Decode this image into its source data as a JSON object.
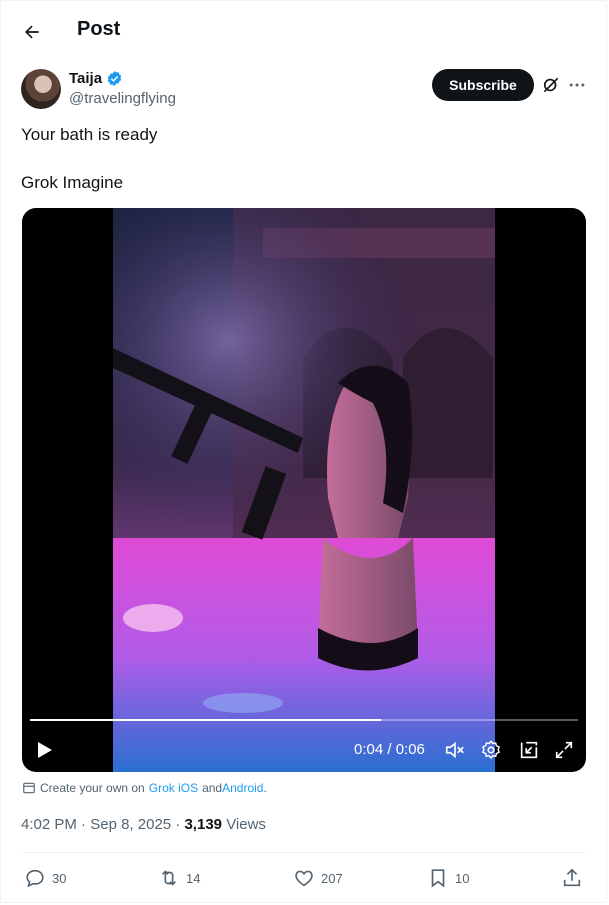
{
  "header": {
    "title": "Post",
    "back_icon": "arrow-left-icon"
  },
  "author": {
    "name": "Taija",
    "handle": "@travelingflying",
    "verified_color": "#1d9bf0",
    "subscribe_label": "Subscribe"
  },
  "post": {
    "line1": "Your bath is ready",
    "line2": "Grok Imagine"
  },
  "video": {
    "time": "0:04 / 0:06",
    "progress": 0.64,
    "icons": [
      "play-icon",
      "mute-icon",
      "settings-icon",
      "picture-in-picture-icon",
      "fullscreen-icon"
    ]
  },
  "grok_note": {
    "prefix": "Create your own on",
    "ios": "Grok iOS",
    "and": "and",
    "android": "Android",
    "suffix": "."
  },
  "meta": {
    "time": "4:02 PM",
    "sep1": "·",
    "date": "Sep 8, 2025",
    "sep2": "·",
    "views_count": "3,139",
    "views_label": "Views"
  },
  "actions": {
    "replies": "30",
    "reposts": "14",
    "likes": "207",
    "bookmarks": "10"
  },
  "colors": {
    "text": "#0f1419",
    "muted": "#536471",
    "link": "#1d9bf0"
  }
}
